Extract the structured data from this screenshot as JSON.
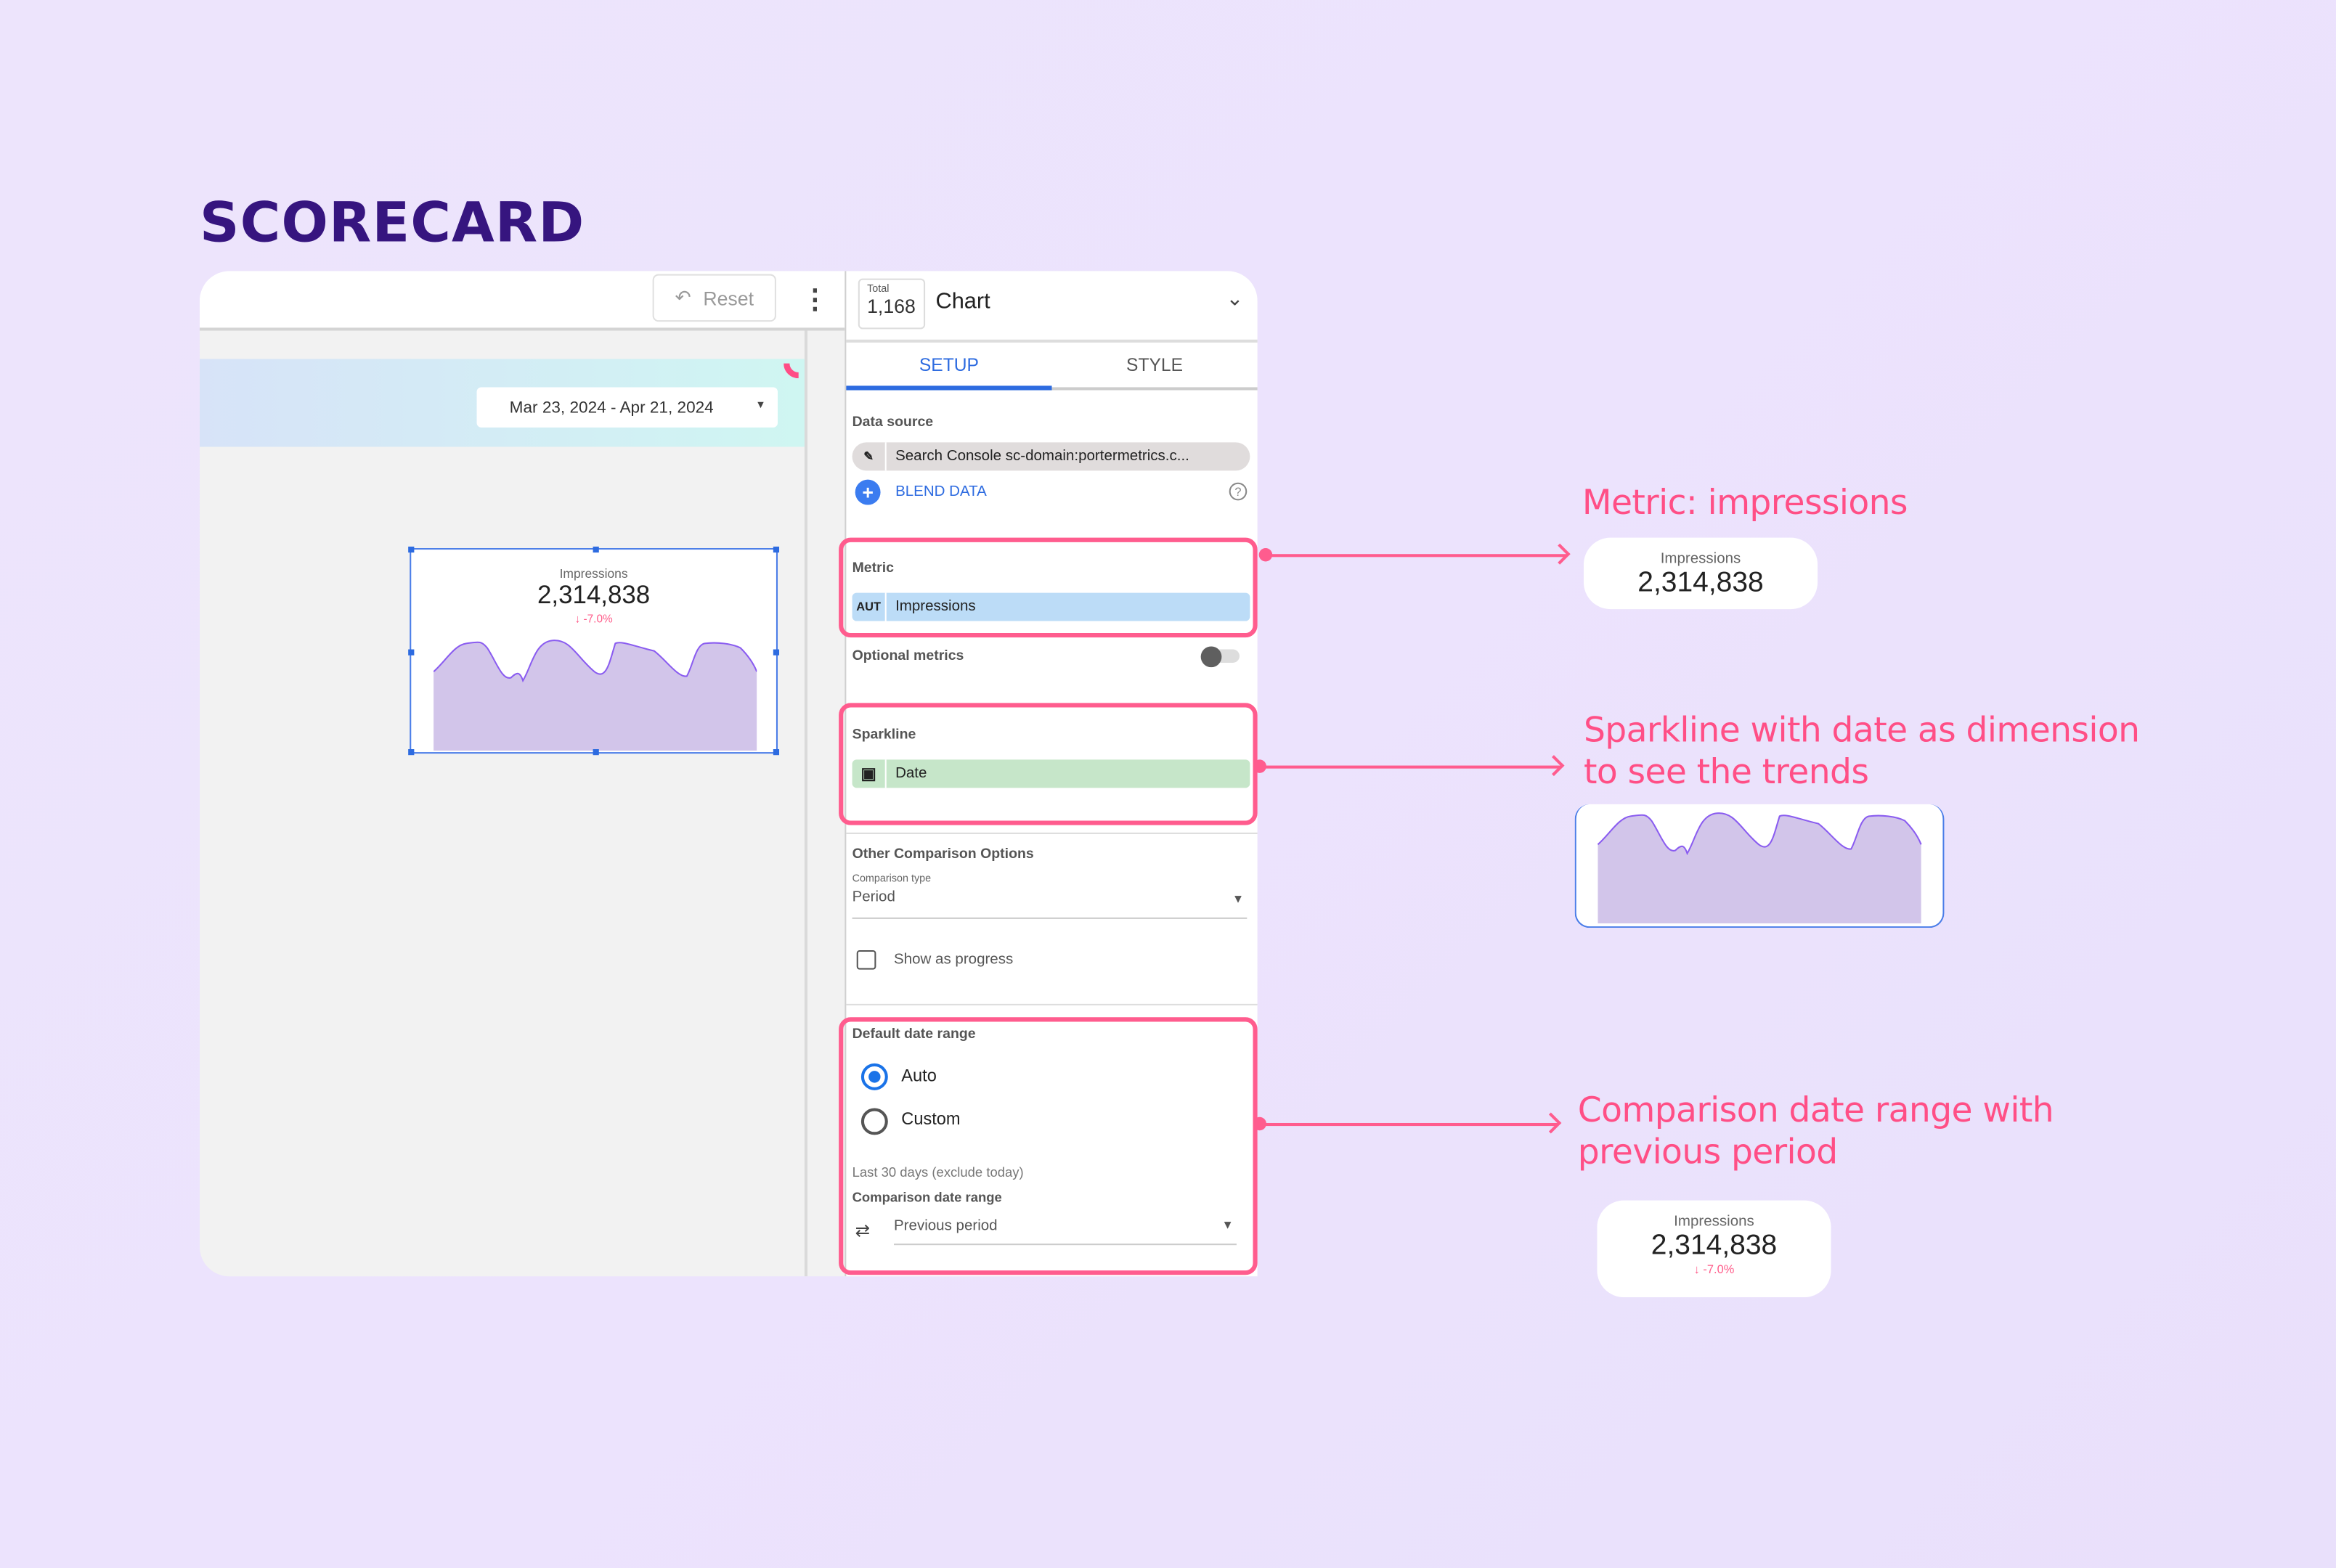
{
  "page": {
    "title": "SCORECARD"
  },
  "toolbar": {
    "reset_label": "Reset",
    "reset_icon": "undo-icon",
    "more_icon": "more-vert-icon"
  },
  "report": {
    "date_range": "Mar 23, 2024 - Apr 21, 2024",
    "scorecard": {
      "label": "Impressions",
      "value": "2,314,838",
      "delta": "-7.0%",
      "delta_arrow": "↓"
    }
  },
  "panel": {
    "total_label": "Total",
    "total_value": "1,168",
    "chart_title": "Chart",
    "tabs": [
      {
        "label": "SETUP",
        "active": true
      },
      {
        "label": "STYLE",
        "active": false
      }
    ],
    "data_source": {
      "label": "Data source",
      "value": "Search Console sc-domain:portermetrics.c...",
      "blend_label": "BLEND DATA"
    },
    "metric": {
      "label": "Metric",
      "type_tag": "AUT",
      "field": "Impressions"
    },
    "optional_metrics": {
      "label": "Optional metrics",
      "enabled": false
    },
    "sparkline": {
      "label": "Sparkline",
      "field": "Date"
    },
    "comparison": {
      "label": "Other Comparison Options",
      "type_label": "Comparison type",
      "type_value": "Period",
      "progress_label": "Show as progress",
      "progress_checked": false
    },
    "date_range": {
      "label": "Default date range",
      "options": [
        {
          "label": "Auto",
          "selected": true
        },
        {
          "label": "Custom",
          "selected": false
        }
      ],
      "hint": "Last 30 days (exclude today)",
      "comparison_label": "Comparison date range",
      "comparison_value": "Previous period"
    }
  },
  "annotations": [
    {
      "text": "Metric: impressions"
    },
    {
      "line1": "Sparkline with date as dimension",
      "line2": "to see the trends"
    },
    {
      "line1": "Comparison date range with",
      "line2": "previous period"
    }
  ],
  "colors": {
    "accent_pink": "#ff5c8e",
    "title": "#36157f",
    "blue": "#2d6be0",
    "sparkline_fill": "#d2c5ea",
    "sparkline_line": "#8a5cf0",
    "metric_chip": "#bcdcf7",
    "dimension_chip": "#c6e6c9"
  }
}
